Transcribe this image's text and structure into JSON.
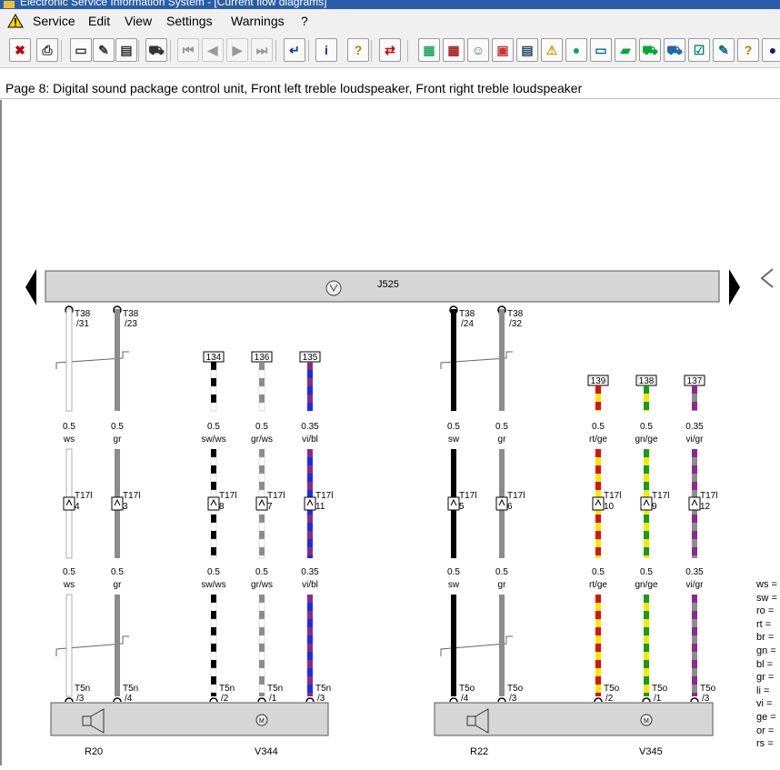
{
  "window": {
    "title": "Electronic Service Information System - [Current flow diagrams]"
  },
  "menu": [
    "Service",
    "Edit",
    "View",
    "Settings",
    "Warnings",
    "?"
  ],
  "page_title": "Page 8: Digital sound package control unit, Front left treble loudspeaker, Front right treble loudspeaker",
  "control_unit": {
    "label": "J525"
  },
  "components": [
    {
      "id": "R20",
      "label": "R20"
    },
    {
      "id": "V344",
      "label": "V344"
    },
    {
      "id": "R22",
      "label": "R22"
    },
    {
      "id": "V345",
      "label": "V345"
    }
  ],
  "wires": [
    {
      "top_conn": "T38",
      "top_pin": "/31",
      "size": "0.5",
      "color": "ws",
      "mid_conn": "T17l",
      "mid_pin": "4",
      "bot_conn": "T5n",
      "bot_pin": "/3",
      "ref": "",
      "colors": [
        "#f4f4f4"
      ]
    },
    {
      "top_conn": "T38",
      "top_pin": "/23",
      "size": "0.5",
      "color": "gr",
      "mid_conn": "T17l",
      "mid_pin": "3",
      "bot_conn": "T5n",
      "bot_pin": "/4",
      "ref": "",
      "colors": [
        "#8c8c8c"
      ]
    },
    {
      "top_conn": "",
      "top_pin": "",
      "size": "0.5",
      "color": "sw/ws",
      "mid_conn": "T17l",
      "mid_pin": "8",
      "bot_conn": "T5n",
      "bot_pin": "/2",
      "ref": "134",
      "colors": [
        "#000000",
        "#ffffff"
      ]
    },
    {
      "top_conn": "",
      "top_pin": "",
      "size": "0.5",
      "color": "gr/ws",
      "mid_conn": "T17l",
      "mid_pin": "7",
      "bot_conn": "T5n",
      "bot_pin": "/1",
      "ref": "136",
      "colors": [
        "#8c8c8c",
        "#ffffff"
      ]
    },
    {
      "top_conn": "",
      "top_pin": "",
      "size": "0.35",
      "color": "vi/bl",
      "mid_conn": "T17l",
      "mid_pin": "11",
      "bot_conn": "T5n",
      "bot_pin": "/3",
      "ref": "135",
      "colors": [
        "#8b2a8b",
        "#1a2cf0"
      ]
    },
    {
      "top_conn": "T38",
      "top_pin": "/24",
      "size": "0.5",
      "color": "sw",
      "mid_conn": "T17l",
      "mid_pin": "5",
      "bot_conn": "T5o",
      "bot_pin": "/4",
      "ref": "",
      "colors": [
        "#000000"
      ]
    },
    {
      "top_conn": "T38",
      "top_pin": "/32",
      "size": "0.5",
      "color": "gr",
      "mid_conn": "T17l",
      "mid_pin": "6",
      "bot_conn": "T5o",
      "bot_pin": "/3",
      "ref": "",
      "colors": [
        "#8c8c8c"
      ]
    },
    {
      "top_conn": "",
      "top_pin": "",
      "size": "0.5",
      "color": "rt/ge",
      "mid_conn": "T17l",
      "mid_pin": "10",
      "bot_conn": "T5o",
      "bot_pin": "/2",
      "ref": "139",
      "colors": [
        "#e01010",
        "#f6e800"
      ]
    },
    {
      "top_conn": "",
      "top_pin": "",
      "size": "0.5",
      "color": "gn/ge",
      "mid_conn": "T17l",
      "mid_pin": "9",
      "bot_conn": "T5o",
      "bot_pin": "/1",
      "ref": "138",
      "colors": [
        "#1a9a1a",
        "#f6e800"
      ]
    },
    {
      "top_conn": "",
      "top_pin": "",
      "size": "0.35",
      "color": "vi/gr",
      "mid_conn": "T17l",
      "mid_pin": "12",
      "bot_conn": "T5o",
      "bot_pin": "/3",
      "ref": "137",
      "colors": [
        "#8b2a8b",
        "#8c8c8c"
      ]
    }
  ],
  "legend": [
    "ws =",
    "sw =",
    "ro =",
    "rt =",
    "br =",
    "gn =",
    "bl =",
    "gr =",
    "li =",
    "vi =",
    "ge =",
    "or =",
    "rs ="
  ],
  "toolbar_icons": [
    "exit-icon",
    "print-icon",
    "new-doc-icon",
    "edit-doc-icon",
    "notes-icon",
    "car-icon",
    "first-page-icon",
    "prev-page-icon",
    "next-page-icon",
    "last-page-icon",
    "return-icon",
    "info-icon",
    "help-icon",
    "switch-icon",
    "book-icon",
    "calculator-icon",
    "person-icon",
    "manual-icon",
    "list-icon",
    "warning-icon",
    "globe-icon",
    "window-icon",
    "tools-icon",
    "car-green-icon",
    "car-search-icon",
    "checklist-icon",
    "pen-icon",
    "question-doc-icon",
    "blue-circle-icon"
  ]
}
